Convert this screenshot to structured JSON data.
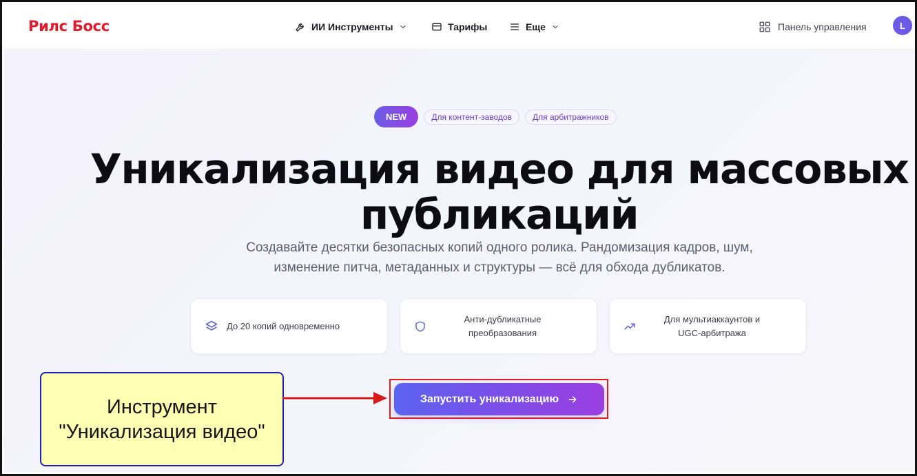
{
  "brand": {
    "name": "Рилс Босс",
    "color": "#e01b2c"
  },
  "nav": {
    "tools": {
      "label": "ИИ Инструменты",
      "icon": "wrench-icon"
    },
    "prices": {
      "label": "Тарифы",
      "icon": "card-icon"
    },
    "more": {
      "label": "Еще",
      "icon": "menu-icon"
    }
  },
  "dashboard": {
    "label": "Панель управления",
    "icon": "grid-icon"
  },
  "user": {
    "initial": "L"
  },
  "badges": {
    "new": "NEW",
    "tags": [
      "Для контент-заводов",
      "Для арбитражников"
    ]
  },
  "hero": {
    "title_line1": "Уникализация видео для массовых",
    "title_line2": "публикаций",
    "sub_line1": "Создавайте десятки безопасных копий одного ролика. Рандомизация кадров, шум,",
    "sub_line2": "изменение питча, метаданных и структуры — всё для обхода дубликатов."
  },
  "features": [
    {
      "icon": "layers-icon",
      "line1": "До 20 копий одновременно",
      "line2": ""
    },
    {
      "icon": "shield-icon",
      "line1": "Анти-дубликатные",
      "line2": "преобразования"
    },
    {
      "icon": "trending-icon",
      "line1": "Для мультиаккаунтов и",
      "line2": "UGC-арбитража"
    }
  ],
  "cta": {
    "label": "Запустить уникализацию",
    "icon": "arrow-right-icon"
  },
  "callout": {
    "line1": "Инструмент",
    "line2": "\"Уникализация видео\""
  },
  "colors": {
    "accent_start": "#5c64ef",
    "accent_end": "#9a3ee0",
    "highlight_border": "#e21d1d",
    "callout_bg": "#ffffb4"
  }
}
